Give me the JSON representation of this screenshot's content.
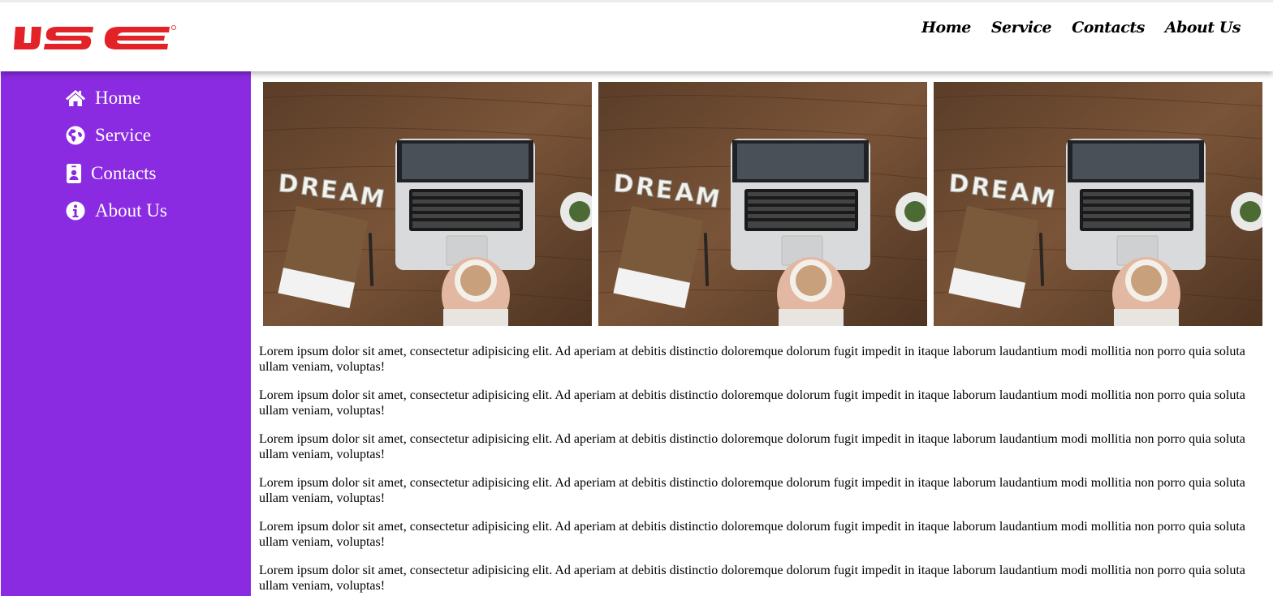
{
  "header": {
    "logo_text": "IJSE",
    "logo_color": "#e32227",
    "nav": [
      {
        "label": "Home"
      },
      {
        "label": "Service"
      },
      {
        "label": "Contacts"
      },
      {
        "label": "About Us"
      }
    ]
  },
  "sidebar": {
    "background": "#8a2be2",
    "items": [
      {
        "label": "Home",
        "icon": "home-icon"
      },
      {
        "label": "Service",
        "icon": "globe-icon"
      },
      {
        "label": "Contacts",
        "icon": "id-badge-icon"
      },
      {
        "label": "About Us",
        "icon": "info-icon"
      }
    ]
  },
  "gallery": [
    {
      "caption_word": "DREAM"
    },
    {
      "caption_word": "DREAM"
    },
    {
      "caption_word": "DREAM"
    }
  ],
  "content": {
    "paragraphs": [
      "Lorem ipsum dolor sit amet, consectetur adipisicing elit. Ad aperiam at debitis distinctio doloremque dolorum fugit impedit in itaque laborum laudantium modi mollitia non porro quia soluta ullam veniam, voluptas!",
      "Lorem ipsum dolor sit amet, consectetur adipisicing elit. Ad aperiam at debitis distinctio doloremque dolorum fugit impedit in itaque laborum laudantium modi mollitia non porro quia soluta ullam veniam, voluptas!",
      "Lorem ipsum dolor sit amet, consectetur adipisicing elit. Ad aperiam at debitis distinctio doloremque dolorum fugit impedit in itaque laborum laudantium modi mollitia non porro quia soluta ullam veniam, voluptas!",
      "Lorem ipsum dolor sit amet, consectetur adipisicing elit. Ad aperiam at debitis distinctio doloremque dolorum fugit impedit in itaque laborum laudantium modi mollitia non porro quia soluta ullam veniam, voluptas!",
      "Lorem ipsum dolor sit amet, consectetur adipisicing elit. Ad aperiam at debitis distinctio doloremque dolorum fugit impedit in itaque laborum laudantium modi mollitia non porro quia soluta ullam veniam, voluptas!",
      "Lorem ipsum dolor sit amet, consectetur adipisicing elit. Ad aperiam at debitis distinctio doloremque dolorum fugit impedit in itaque laborum laudantium modi mollitia non porro quia soluta ullam veniam, voluptas!"
    ]
  }
}
